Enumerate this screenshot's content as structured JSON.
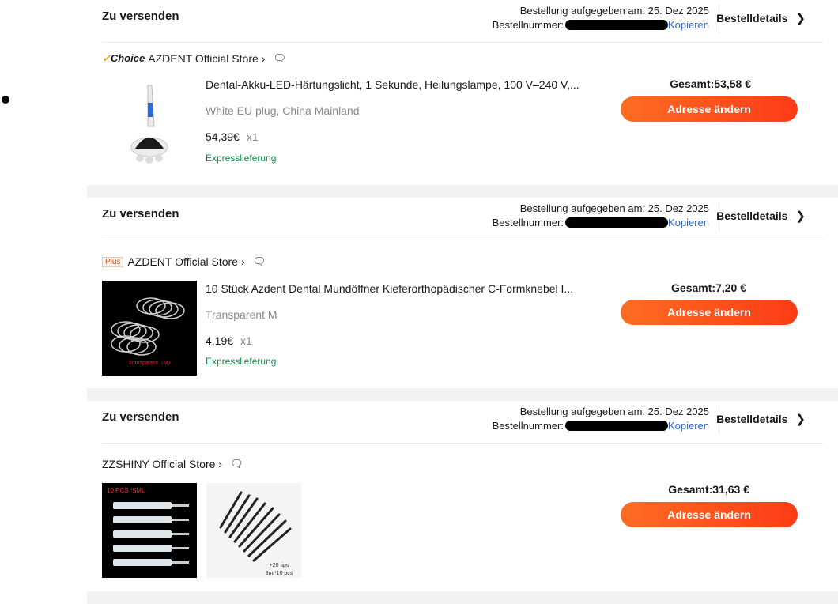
{
  "orders": [
    {
      "status": "Zu versenden",
      "placed_label": "Bestellung aufgegeben am: 25. Dez 2025",
      "number_label": "Bestellnummer:",
      "copy_label": "Kopieren",
      "details_label": "Bestelldetails",
      "store_badge": "Choice",
      "store_name": "AZDENT Official Store",
      "product_name": "Dental-Akku-LED-Härtungslicht, 1 Sekunde, Heilungslampe, 100 V–240 V,...",
      "variant": "White EU plug, China Mainland",
      "price": "54,39€",
      "quantity": "x1",
      "shipping": "Expresslieferung",
      "total": "Gesamt:53,58 €",
      "action_label": "Adresse ändern"
    },
    {
      "status": "Zu versenden",
      "placed_label": "Bestellung aufgegeben am: 25. Dez 2025",
      "number_label": "Bestellnummer:",
      "copy_label": "Kopieren",
      "details_label": "Bestelldetails",
      "store_badge": "Plus",
      "store_name": "AZDENT Official Store",
      "product_name": "10 Stück Azdent Dental Mundöffner Kieferorthopädischer C-Formknebel I...",
      "variant": "Transparent M",
      "image_caption": "Transparent（M）",
      "price": "4,19€",
      "quantity": "x1",
      "shipping": "Expresslieferung",
      "total": "Gesamt:7,20 €",
      "action_label": "Adresse ändern"
    },
    {
      "status": "Zu versenden",
      "placed_label": "Bestellung aufgegeben am: 25. Dez 2025",
      "number_label": "Bestellnummer:",
      "copy_label": "Kopieren",
      "details_label": "Bestelldetails",
      "store_name": "ZZSHINY Official Store",
      "image1_caption": "10 PCS *5ML",
      "image2_caption_1": "+20 tips",
      "image2_caption_2": "3ml*10 pcs",
      "total": "Gesamt:31,63 €",
      "action_label": "Adresse ändern"
    }
  ],
  "colors": {
    "accent": "#fd4a18",
    "link": "#2b64d1",
    "shipping": "#138a4a",
    "separator": "#f2f2f2"
  }
}
